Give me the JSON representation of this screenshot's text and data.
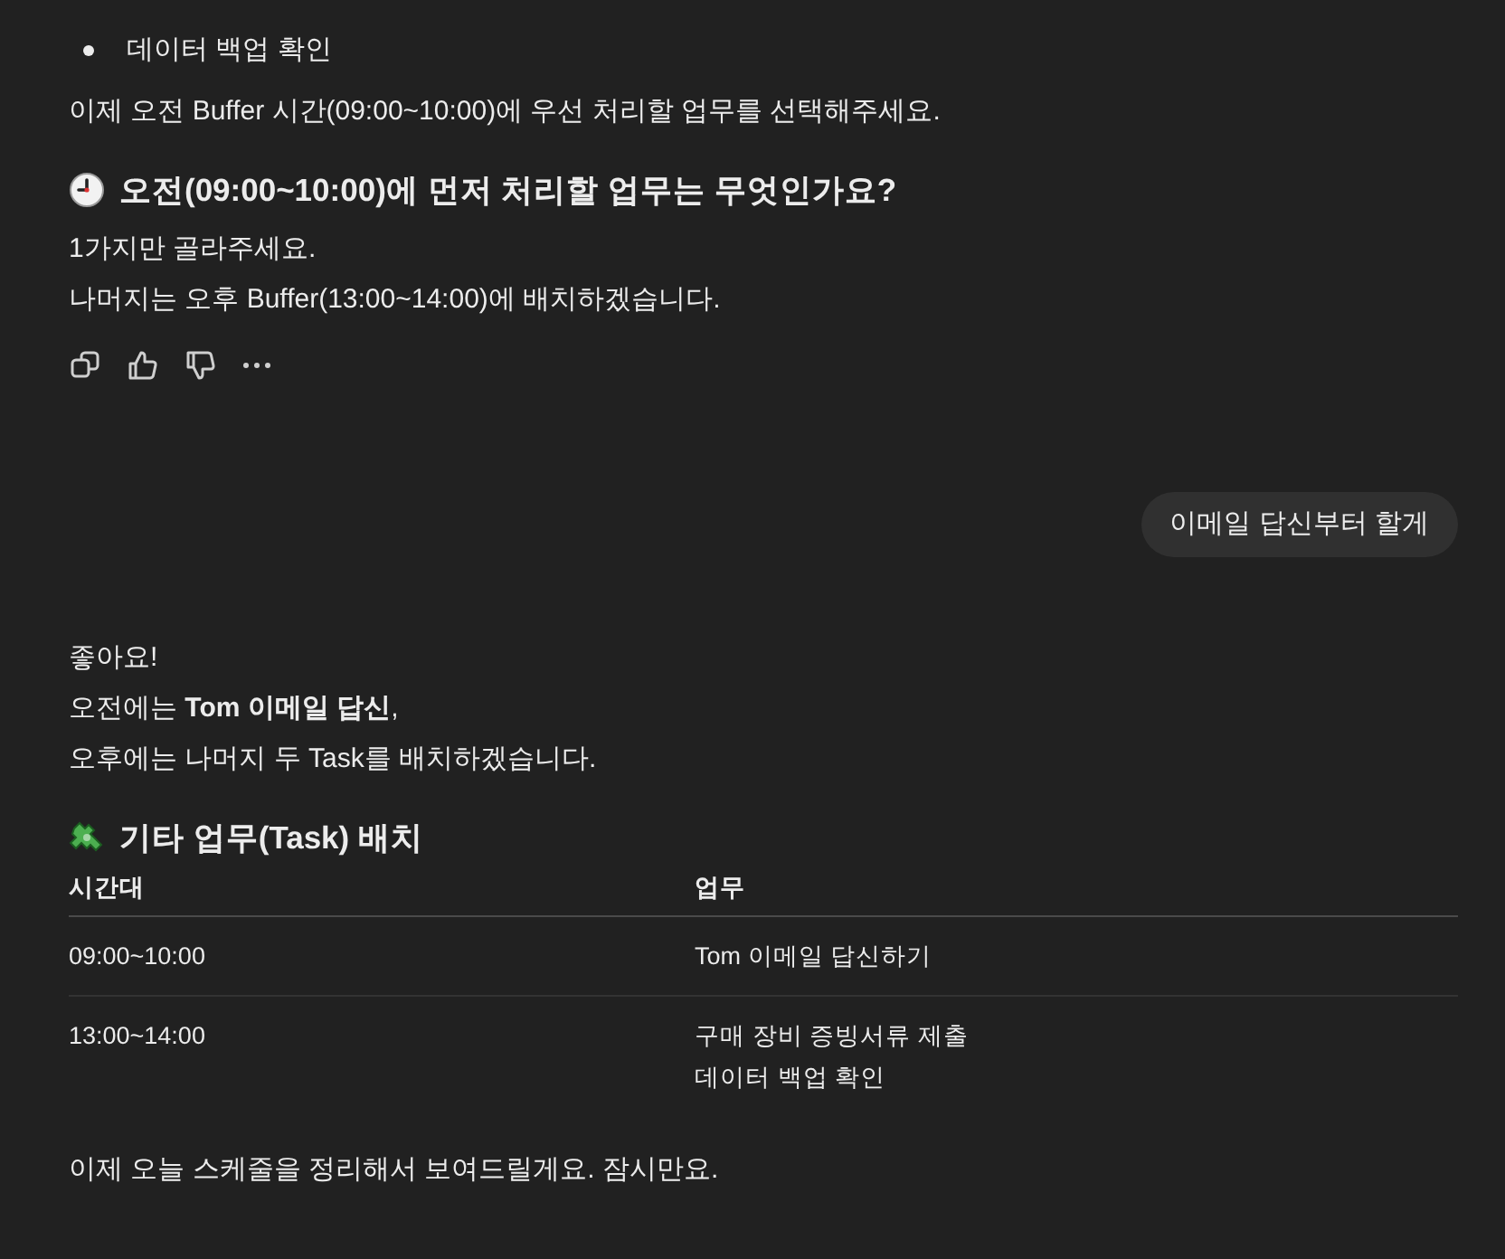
{
  "assistant_message_1": {
    "blocks": [
      {
        "kind": "bullet",
        "text": "데이터 백업 확인"
      },
      {
        "kind": "paragraph",
        "lines": [
          "이제 오전 Buffer 시간(09:00~10:00)에 우선 처리할 업무를 선택해주세요."
        ]
      },
      {
        "kind": "heading",
        "text": "오전(09:00~10:00)에 먼저 처리할 업무는 무엇인가요?"
      },
      {
        "kind": "paragraph",
        "lines": [
          "1가지만 골라주세요.",
          "나머지는 오후 Buffer(13:00~14:00)에 배치하겠습니다."
        ]
      }
    ]
  },
  "user_message": {
    "text": "이메일 답신부터 할게"
  },
  "assistant_message_2": {
    "blocks": [
      {
        "kind": "paragraph",
        "lines": [
          "좋아요!",
          "오전에는 **Tom 이메일 답신**,",
          "오후에는 나머지 두 Task를 배치하겠습니다."
        ]
      },
      {
        "kind": "heading",
        "text": "기타 업무(Task) 배치"
      },
      {
        "kind": "table",
        "columns": [
          "시간대",
          "업무"
        ],
        "rows": [
          {
            "cells": [
              [
                "09:00~10:00"
              ],
              [
                "Tom 이메일 답신하기"
              ]
            ]
          },
          {
            "cells": [
              [
                "13:00~14:00"
              ],
              [
                "구매 장비 증빙서류 제출",
                "데이터 백업 확인"
              ]
            ]
          }
        ]
      },
      {
        "kind": "paragraph",
        "lines": [
          "이제 오늘 스케줄을 정리해서 보여드릴게요. 잠시만요."
        ]
      }
    ]
  }
}
